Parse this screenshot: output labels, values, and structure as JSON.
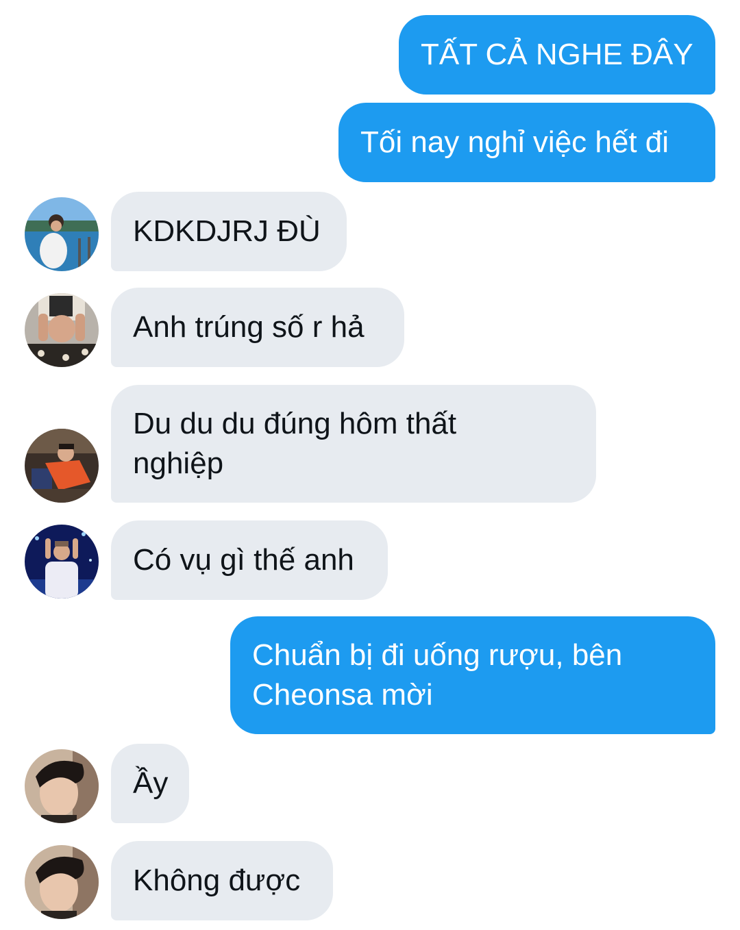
{
  "conversation": {
    "messages": [
      {
        "id": "m1",
        "direction": "outgoing",
        "text": "TẤT CẢ NGHE ĐÂY"
      },
      {
        "id": "m2",
        "direction": "outgoing",
        "text": "Tối nay nghỉ việc hết đi"
      },
      {
        "id": "m3",
        "direction": "incoming",
        "avatar": "avatar-beach",
        "text": "KDKDJRJ ĐÙ"
      },
      {
        "id": "m4",
        "direction": "incoming",
        "avatar": "avatar-hands-face",
        "text": "Anh trúng số r hả"
      },
      {
        "id": "m5",
        "direction": "incoming",
        "avatar": "avatar-orange-shirt",
        "text": "Du du du đúng hôm thất nghiệp"
      },
      {
        "id": "m6",
        "direction": "incoming",
        "avatar": "avatar-concert",
        "text": "Có vụ gì thế anh"
      },
      {
        "id": "m7",
        "direction": "outgoing",
        "text": "Chuẩn bị đi uống rượu, bên Cheonsa mời"
      },
      {
        "id": "m8",
        "direction": "incoming",
        "avatar": "avatar-portrait",
        "text": "Ầy"
      },
      {
        "id": "m9",
        "direction": "incoming",
        "avatar": "avatar-portrait",
        "text": "Không được"
      }
    ]
  },
  "colors": {
    "outgoing_bubble": "#1d9bf0",
    "incoming_bubble": "#e7ebf0",
    "outgoing_text": "#ffffff",
    "incoming_text": "#0f1419",
    "background": "#ffffff"
  }
}
